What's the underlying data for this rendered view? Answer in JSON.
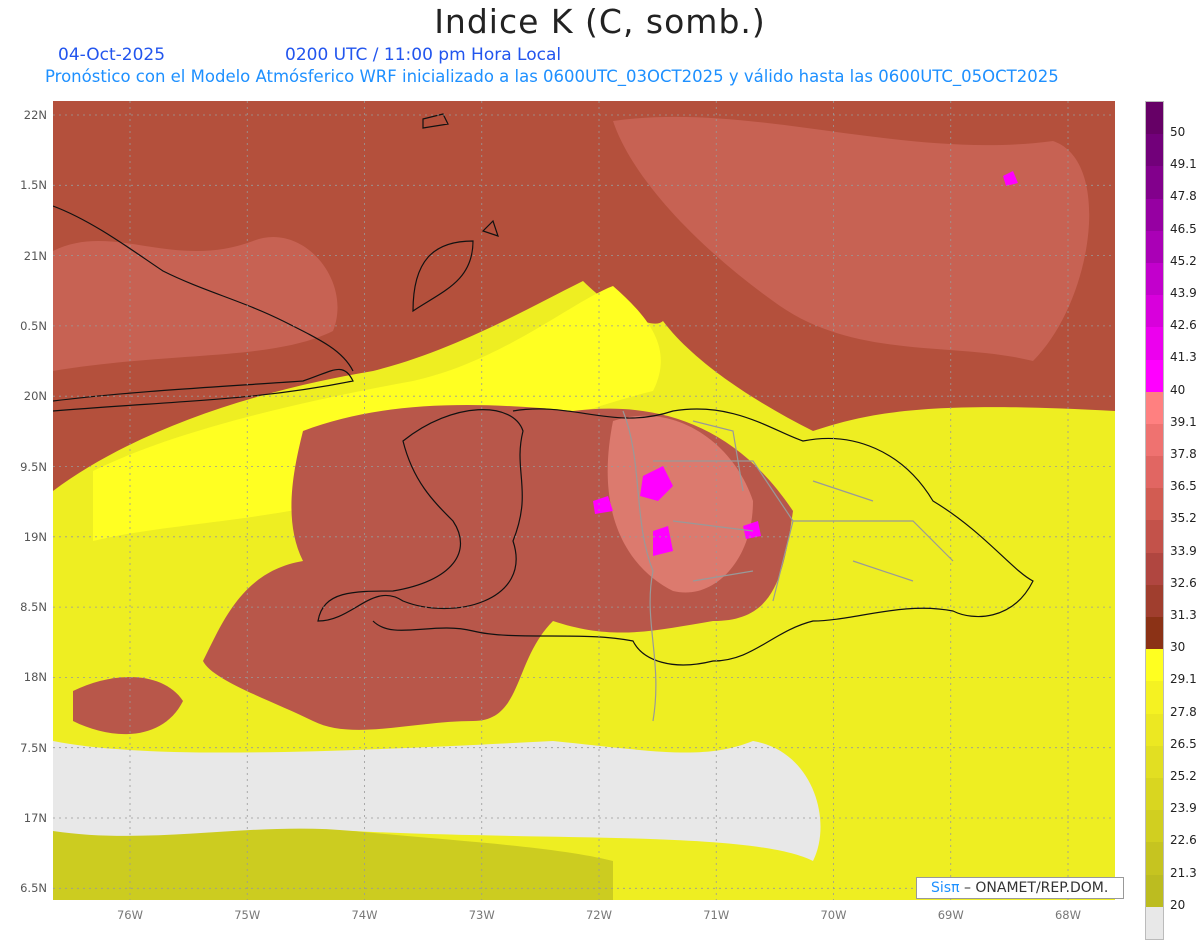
{
  "header": {
    "title": "Indice K (C, somb.)",
    "date": "04-Oct-2025",
    "time": "0200 UTC / 11:00 pm Hora Local",
    "subtitle": "Pronóstico con el Modelo Atmósferico WRF inicializado a las 0600UTC_03OCT2025 y válido hasta las  0600UTC_05OCT2025"
  },
  "axes": {
    "lat_labels": [
      "22N",
      "1.5N",
      "21N",
      "0.5N",
      "20N",
      "9.5N",
      "19N",
      "8.5N",
      "18N",
      "7.5N",
      "17N",
      "6.5N"
    ],
    "lon_labels": [
      "76W",
      "75W",
      "74W",
      "73W",
      "72W",
      "71W",
      "70W",
      "69W",
      "68W"
    ]
  },
  "colorbar": {
    "labels": [
      "50",
      "49.1",
      "47.8",
      "46.5",
      "45.2",
      "43.9",
      "42.6",
      "41.3",
      "40",
      "39.1",
      "37.8",
      "36.5",
      "35.2",
      "33.9",
      "32.6",
      "31.3",
      "30",
      "29.1",
      "27.8",
      "26.5",
      "25.2",
      "23.9",
      "22.6",
      "21.3",
      "20"
    ],
    "colors": [
      "#660066",
      "#72007a",
      "#82008c",
      "#9600a2",
      "#aa00b6",
      "#c200cc",
      "#d800dc",
      "#ec00ee",
      "#ff00ff",
      "#ff8080",
      "#ef7270",
      "#e16662",
      "#d25c52",
      "#c3524a",
      "#b04640",
      "#a03e2e",
      "#8b3216",
      "#ffff20",
      "#f5f222",
      "#ece822",
      "#e2df22",
      "#d9d620",
      "#d1cf20",
      "#c6c420",
      "#bcbc20",
      "#e8e8e8"
    ]
  },
  "credit": {
    "brand": "Sisπ",
    "text": "– ONAMET/REP.DOM."
  }
}
